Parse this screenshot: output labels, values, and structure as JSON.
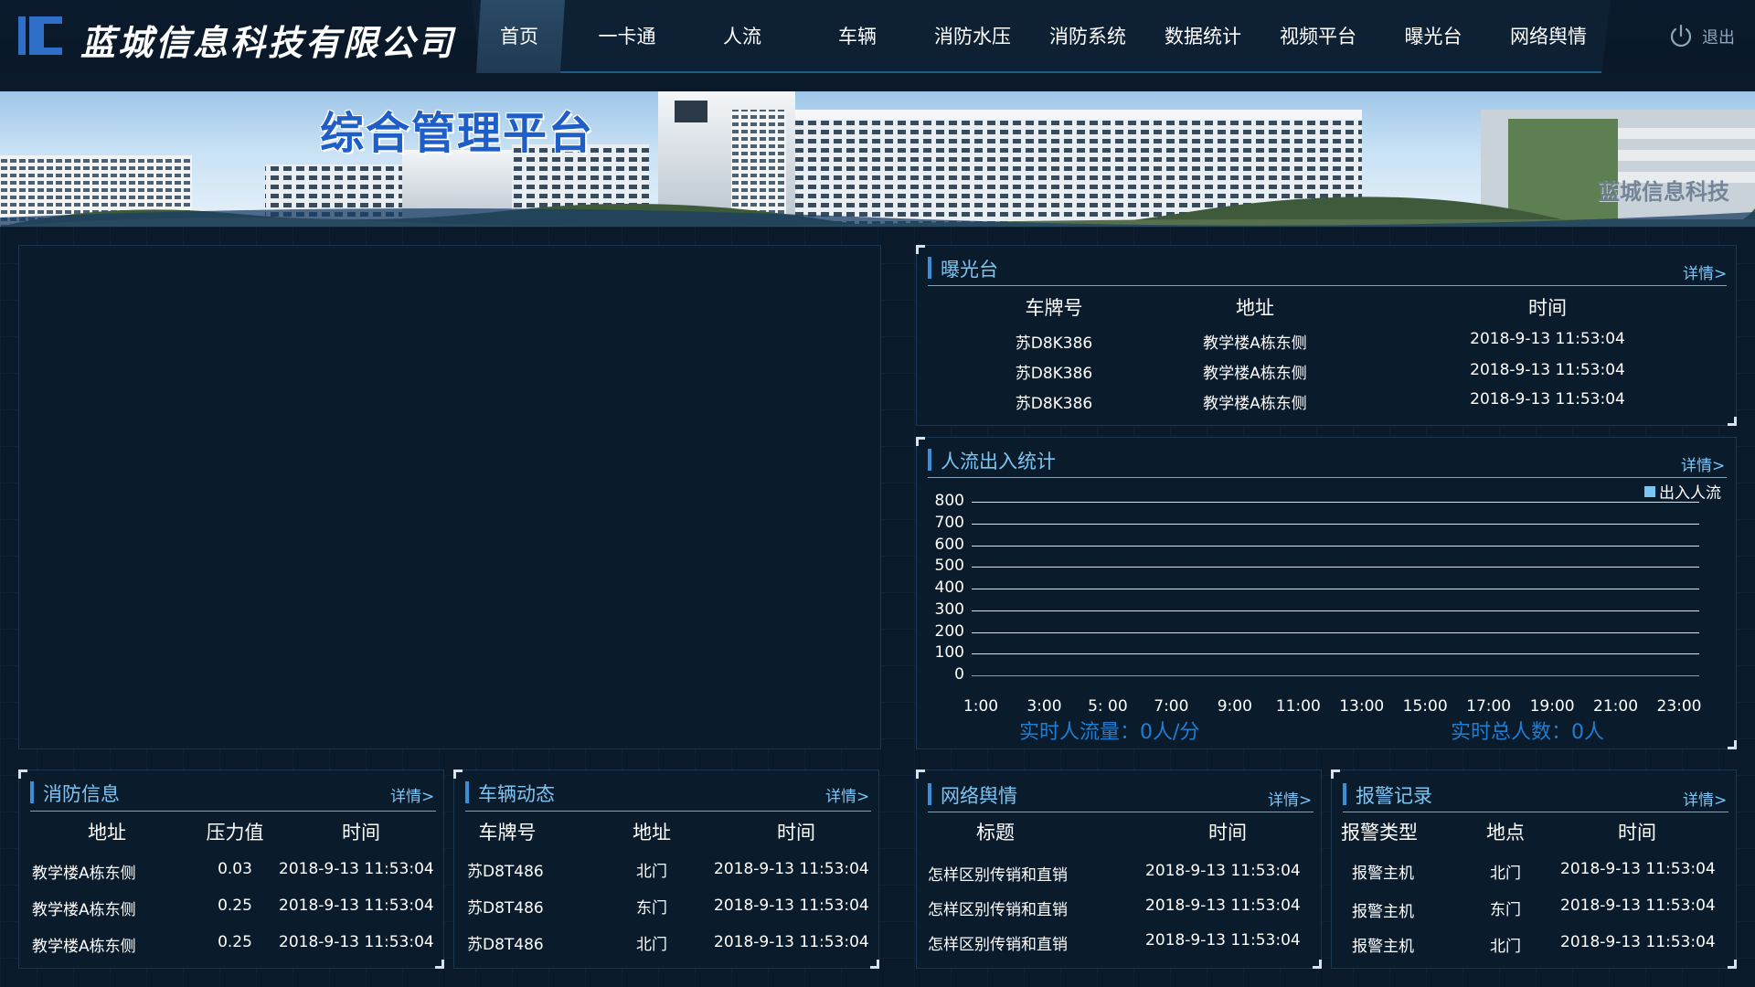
{
  "header": {
    "company_name": "蓝城信息科技有限公司",
    "logout_label": "退出",
    "nav": [
      {
        "label": "首页",
        "active": true
      },
      {
        "label": "一卡通"
      },
      {
        "label": "人流"
      },
      {
        "label": "车辆"
      },
      {
        "label": "消防水压"
      },
      {
        "label": "消防系统"
      },
      {
        "label": "数据统计"
      },
      {
        "label": "视频平台"
      },
      {
        "label": "曝光台"
      },
      {
        "label": "网络舆情"
      }
    ]
  },
  "banner": {
    "title": "综合管理平台",
    "brand": "蓝城信息科技"
  },
  "colors": {
    "accent": "#7ec4f2",
    "stat_text": "#1f7ed0",
    "background": "#0a1a2b"
  },
  "exposure": {
    "title": "曝光台",
    "more": "详情>",
    "columns": [
      "车牌号",
      "地址",
      "时间"
    ],
    "rows": [
      [
        "苏D8K386",
        "教学楼A栋东侧",
        "2018-9-13  11:53:04"
      ],
      [
        "苏D8K386",
        "教学楼A栋东侧",
        "2018-9-13  11:53:04"
      ],
      [
        "苏D8K386",
        "教学楼A栋东侧",
        "2018-9-13  11:53:04"
      ]
    ]
  },
  "traffic": {
    "title": "人流出入统计",
    "more": "详情>",
    "realtime_flow": "实时人流量：0人/分",
    "realtime_total": "实时总人数：0人"
  },
  "chart_data": {
    "type": "line",
    "title": "",
    "xlabel": "",
    "ylabel": "",
    "categories": [
      "1:00",
      "3:00",
      "5: 00",
      "7:00",
      "9:00",
      "11:00",
      "13:00",
      "15:00",
      "17:00",
      "19:00",
      "21:00",
      "23:00"
    ],
    "series": [
      {
        "name": "出入人流",
        "values": [],
        "color": "#7ec4f2"
      }
    ],
    "y_ticks": [
      "0",
      "100",
      "200",
      "300",
      "400",
      "500",
      "600",
      "700",
      "800"
    ],
    "ylim": [
      0,
      800
    ],
    "grid": true,
    "legend": "top-right"
  },
  "fire_info": {
    "title": "消防信息",
    "more": "详情>",
    "columns": [
      "地址",
      "压力值",
      "时间"
    ],
    "rows": [
      [
        "教学楼A栋东侧",
        "0.03",
        "2018-9-13  11:53:04"
      ],
      [
        "教学楼A栋东侧",
        "0.25",
        "2018-9-13  11:53:04"
      ],
      [
        "教学楼A栋东侧",
        "0.25",
        "2018-9-13  11:53:04"
      ]
    ]
  },
  "vehicle": {
    "title": "车辆动态",
    "more": "详情>",
    "columns": [
      "车牌号",
      "地址",
      "时间"
    ],
    "rows": [
      [
        "苏D8T486",
        "北门",
        "2018-9-13  11:53:04"
      ],
      [
        "苏D8T486",
        "东门",
        "2018-9-13  11:53:04"
      ],
      [
        "苏D8T486",
        "北门",
        "2018-9-13  11:53:04"
      ]
    ]
  },
  "opinion": {
    "title": "网络舆情",
    "more": "详情>",
    "columns": [
      "标题",
      "时间"
    ],
    "rows": [
      [
        "怎样区别传销和直销",
        "2018-9-13  11:53:04"
      ],
      [
        "怎样区别传销和直销",
        "2018-9-13  11:53:04"
      ],
      [
        "怎样区别传销和直销",
        "2018-9-13  11:53:04"
      ]
    ]
  },
  "alarm": {
    "title": "报警记录",
    "more": "详情>",
    "columns": [
      "报警类型",
      "地点",
      "时间"
    ],
    "rows": [
      [
        "报警主机",
        "北门",
        "2018-9-13  11:53:04"
      ],
      [
        "报警主机",
        "东门",
        "2018-9-13  11:53:04"
      ],
      [
        "报警主机",
        "北门",
        "2018-9-13  11:53:04"
      ]
    ]
  }
}
